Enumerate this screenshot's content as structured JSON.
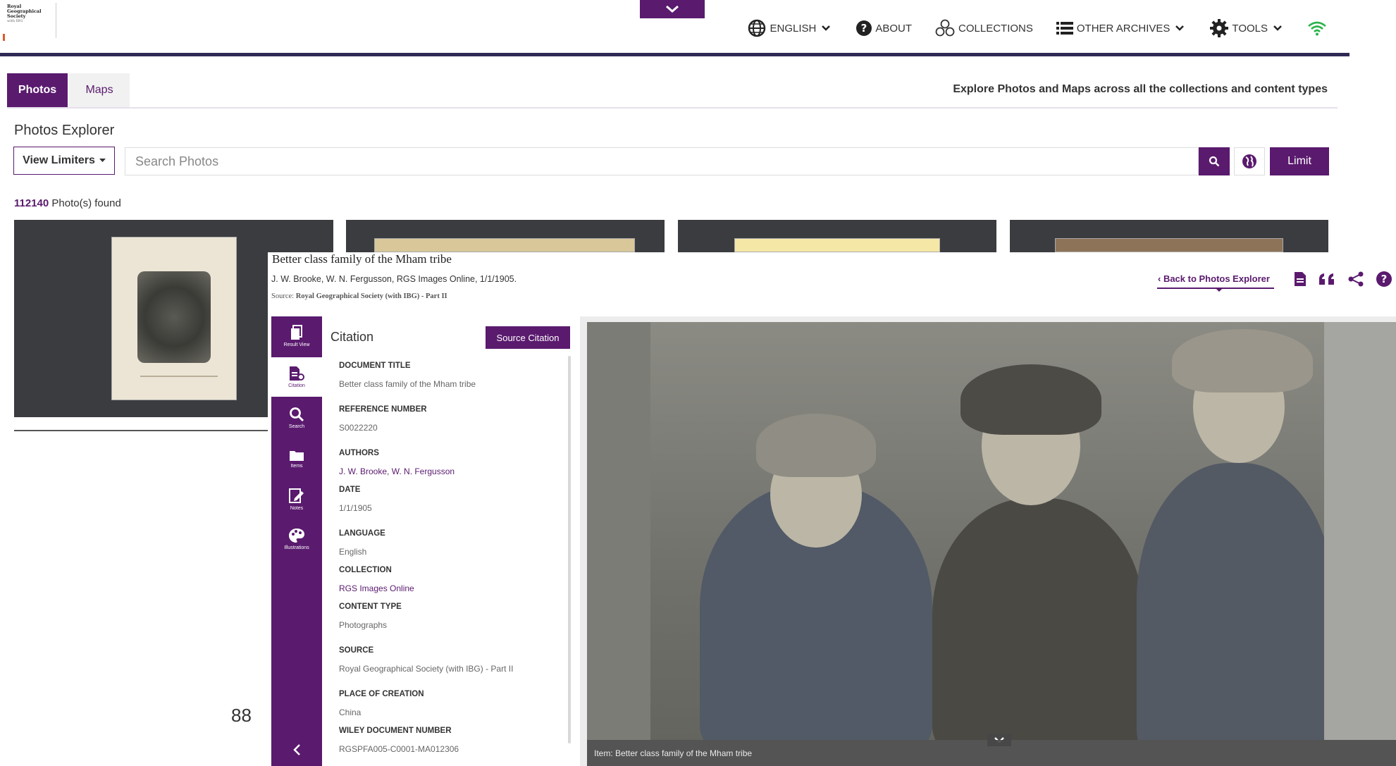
{
  "brand": {
    "logo_lines": [
      "Royal",
      "Geographical",
      "Society",
      "with IBG"
    ],
    "accent": "#5a1a6e",
    "header_rule": "#2e2a55"
  },
  "header": {
    "dropdown_icon": "chevron-down-icon",
    "nav": [
      {
        "label": "ENGLISH",
        "icon": "globe-icon",
        "dropdown": true
      },
      {
        "label": "ABOUT",
        "icon": "question-circle-icon",
        "dropdown": false
      },
      {
        "label": "COLLECTIONS",
        "icon": "collections-icon",
        "dropdown": false
      },
      {
        "label": "OTHER ARCHIVES",
        "icon": "list-icon",
        "dropdown": true
      },
      {
        "label": "TOOLS",
        "icon": "gear-icon",
        "dropdown": true
      }
    ],
    "status_icon": "wifi-icon"
  },
  "tabs": {
    "items": [
      "Photos",
      "Maps"
    ],
    "active": "Photos",
    "explore_text": "Explore Photos and Maps across all the collections and content types"
  },
  "explorer": {
    "title": "Photos Explorer",
    "limiters_label": "View Limiters",
    "search_placeholder": "Search Photos",
    "limit_label": "Limit",
    "found_count": "112140",
    "found_suffix": "Photo(s) found"
  },
  "detail": {
    "title": "Better class family of the Mham tribe",
    "byline": "J. W. Brooke, W. N. Fergusson, RGS Images Online, 1/1/1905.",
    "source_prefix": "Source:",
    "source_value": "Royal Geographical Society (with IBG) - Part II",
    "back_link": "‹ Back to Photos Explorer",
    "tool_icons": [
      "pdf-icon",
      "quote-icon",
      "share-icon",
      "help-icon"
    ],
    "sidebar": [
      {
        "label": "Result View",
        "icon": "document-icon"
      },
      {
        "label": "Citation",
        "icon": "citation-icon",
        "active": true
      },
      {
        "label": "Search",
        "icon": "search-icon"
      },
      {
        "label": "Items",
        "icon": "folder-icon"
      },
      {
        "label": "Notes",
        "icon": "notes-icon"
      },
      {
        "label": "Illustrations",
        "icon": "palette-icon"
      }
    ],
    "citation": {
      "heading": "Citation",
      "source_button": "Source Citation",
      "fields": [
        {
          "label": "DOCUMENT TITLE",
          "value": "Better class family of the Mham tribe"
        },
        {
          "label": "REFERENCE NUMBER",
          "value": "S0022220"
        },
        {
          "label": "AUTHORS",
          "value": "J. W. Brooke,  W. N. Fergusson",
          "link": true
        },
        {
          "label": "DATE",
          "value": "1/1/1905"
        },
        {
          "label": "LANGUAGE",
          "value": "English"
        },
        {
          "label": "COLLECTION",
          "value": "RGS Images Online",
          "link": true
        },
        {
          "label": "CONTENT TYPE",
          "value": "Photographs"
        },
        {
          "label": "SOURCE",
          "value": "Royal Geographical Society (with IBG) - Part II"
        },
        {
          "label": "PLACE OF CREATION",
          "value": "China"
        },
        {
          "label": "WILEY DOCUMENT NUMBER",
          "value": "RGSPFA005-C0001-MA012306"
        }
      ]
    },
    "viewer_caption": "Item: Better class family of the Mham tribe"
  },
  "page_number": "88"
}
